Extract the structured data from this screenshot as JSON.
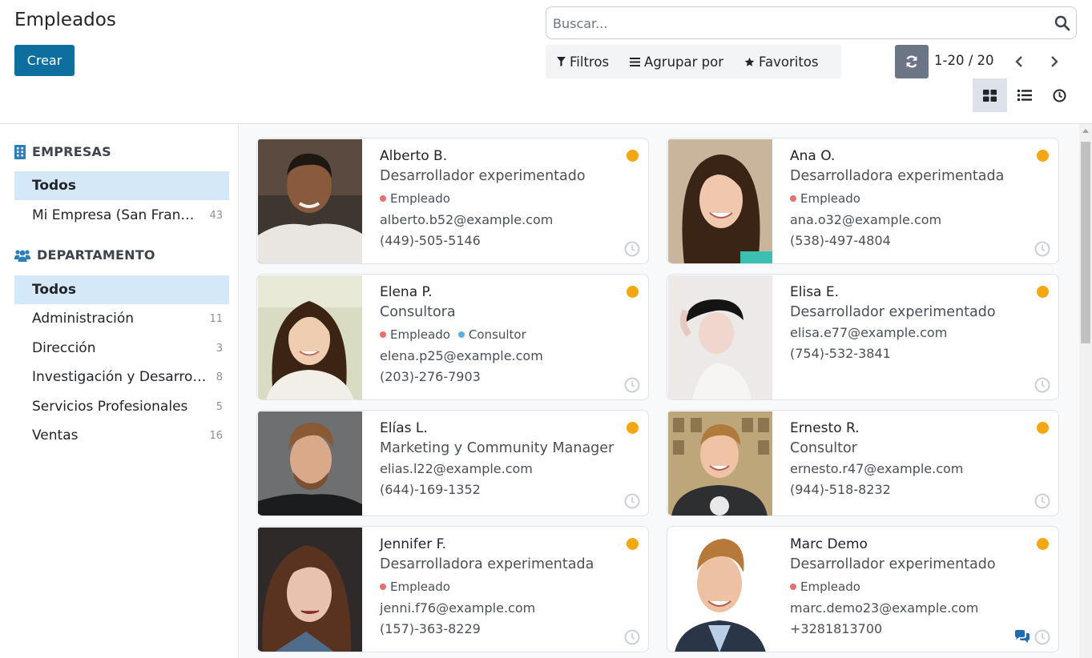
{
  "header": {
    "title": "Empleados",
    "create_label": "Crear",
    "search_placeholder": "Buscar...",
    "filters_label": "Filtros",
    "group_label": "Agrupar por",
    "favorites_label": "Favoritos",
    "pager": "1-20 / 20"
  },
  "colors": {
    "primary": "#0d6f9e",
    "status_dot": "#f3a712",
    "tag_employee": "#e87070",
    "tag_consultant": "#5aaee3",
    "sidebar_active": "#d4e8f7"
  },
  "sidebar": {
    "companies_header": "EMPRESAS",
    "companies": [
      {
        "label": "Todos",
        "count": ""
      },
      {
        "label": "Mi Empresa (San Francisco)",
        "count": "43"
      }
    ],
    "department_header": "DEPARTAMENTO",
    "departments": [
      {
        "label": "Todos",
        "count": ""
      },
      {
        "label": "Administración",
        "count": "11"
      },
      {
        "label": "Dirección",
        "count": "3"
      },
      {
        "label": "Investigación y Desarrollo",
        "count": "8"
      },
      {
        "label": "Servicios Profesionales",
        "count": "5"
      },
      {
        "label": "Ventas",
        "count": "16"
      }
    ]
  },
  "employees": [
    {
      "name": "Alberto B.",
      "job": "Desarrollador experimentado",
      "tags": [
        "Empleado"
      ],
      "email": "alberto.b52@example.com",
      "phone": "(449)-505-5146"
    },
    {
      "name": "Ana O.",
      "job": "Desarrolladora experimentada",
      "tags": [
        "Empleado"
      ],
      "email": "ana.o32@example.com",
      "phone": "(538)-497-4804"
    },
    {
      "name": "Elena P.",
      "job": "Consultora",
      "tags": [
        "Empleado",
        "Consultor"
      ],
      "email": "elena.p25@example.com",
      "phone": "(203)-276-7903"
    },
    {
      "name": "Elisa E.",
      "job": "Desarrollador experimentado",
      "tags": [],
      "email": "elisa.e77@example.com",
      "phone": "(754)-532-3841"
    },
    {
      "name": "Elías L.",
      "job": "Marketing y Community Manager",
      "tags": [],
      "email": "elias.l22@example.com",
      "phone": "(644)-169-1352"
    },
    {
      "name": "Ernesto R.",
      "job": "Consultor",
      "tags": [],
      "email": "ernesto.r47@example.com",
      "phone": "(944)-518-8232"
    },
    {
      "name": "Jennifer F.",
      "job": "Desarrolladora experimentada",
      "tags": [
        "Empleado"
      ],
      "email": "jenni.f76@example.com",
      "phone": "(157)-363-8229"
    },
    {
      "name": "Marc Demo",
      "job": "Desarrollador experimentado",
      "tags": [
        "Empleado"
      ],
      "email": "marc.demo23@example.com",
      "phone": "+3281813700"
    }
  ]
}
